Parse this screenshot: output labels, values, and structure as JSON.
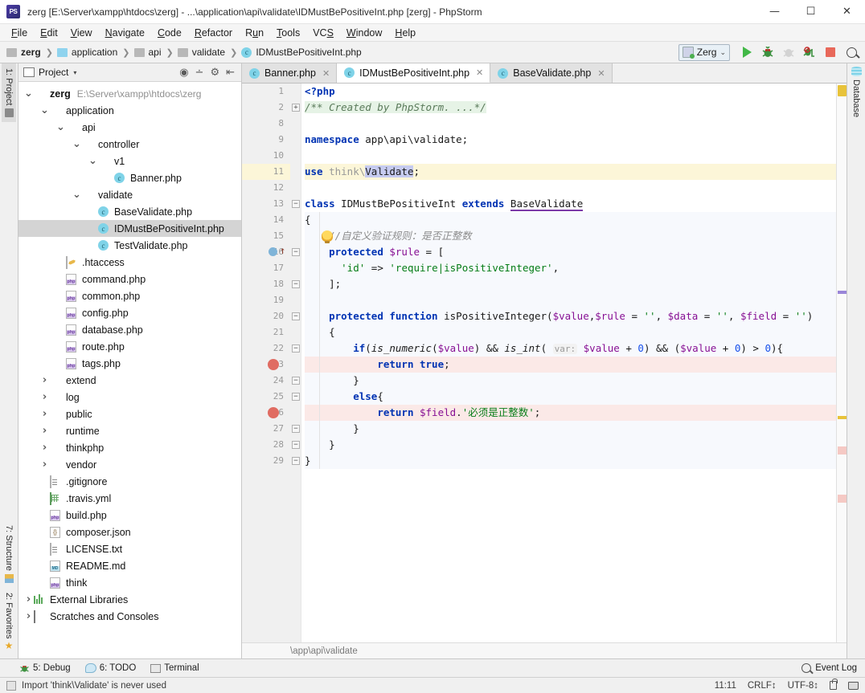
{
  "window": {
    "title": "zerg [E:\\Server\\xampp\\htdocs\\zerg] - ...\\application\\api\\validate\\IDMustBePositiveInt.php [zerg] - PhpStorm",
    "app_name": "PhpStorm",
    "logo_text": "PS",
    "minimize": "—",
    "maximize": "☐",
    "close": "✕"
  },
  "menubar": {
    "items": [
      {
        "label": "File",
        "mnemonic": "F"
      },
      {
        "label": "Edit",
        "mnemonic": "E"
      },
      {
        "label": "View",
        "mnemonic": "V"
      },
      {
        "label": "Navigate",
        "mnemonic": "N"
      },
      {
        "label": "Code",
        "mnemonic": "C"
      },
      {
        "label": "Refactor",
        "mnemonic": "R"
      },
      {
        "label": "Run",
        "mnemonic": "u"
      },
      {
        "label": "Tools",
        "mnemonic": "T"
      },
      {
        "label": "VCS",
        "mnemonic": "S"
      },
      {
        "label": "Window",
        "mnemonic": "W"
      },
      {
        "label": "Help",
        "mnemonic": "H"
      }
    ]
  },
  "breadcrumb": {
    "separator": "❯",
    "items": [
      {
        "label": "zerg",
        "icon": "folder-icon",
        "bold": true
      },
      {
        "label": "application",
        "icon": "folder-blue-icon",
        "bold": false
      },
      {
        "label": "api",
        "icon": "folder-icon",
        "bold": false
      },
      {
        "label": "validate",
        "icon": "folder-icon",
        "bold": false
      },
      {
        "label": "IDMustBePositiveInt.php",
        "icon": "php-class-icon",
        "bold": false
      }
    ]
  },
  "toolbar": {
    "run_config": "Zerg",
    "run_config_chevron": "⌄",
    "buttons": [
      {
        "name": "run-button",
        "icon": "play-icon"
      },
      {
        "name": "debug-button",
        "icon": "bug-icon"
      },
      {
        "name": "rerun-button",
        "icon": "bug-faded-icon"
      },
      {
        "name": "stop-debug-button",
        "icon": "bug-stop-icon"
      },
      {
        "name": "stop-button",
        "icon": "stop-square-icon"
      },
      {
        "name": "search-everywhere-button",
        "icon": "search-icon"
      }
    ]
  },
  "left_rail": {
    "top": [
      {
        "label": "1: Project",
        "mnemonic": "1",
        "active": true
      }
    ],
    "bottom": [
      {
        "label": "7: Structure",
        "mnemonic": "7",
        "active": false
      },
      {
        "label": "2: Favorites",
        "mnemonic": "2",
        "active": false
      }
    ]
  },
  "right_rail": {
    "items": [
      {
        "label": "Database",
        "icon": "database-icon"
      }
    ]
  },
  "project_panel": {
    "title": "Project",
    "caret": "▾",
    "toolbar_icons": [
      "locate-icon",
      "collapse-all-icon",
      "settings-gear-icon",
      "hide-panel-icon"
    ],
    "tree": [
      {
        "depth": 0,
        "arrow": "v",
        "icon": "folder-icon",
        "label": "zerg",
        "bold": true,
        "path": "E:\\Server\\xampp\\htdocs\\zerg",
        "selected": false
      },
      {
        "depth": 1,
        "arrow": "v",
        "icon": "folder-blue-icon",
        "label": "application",
        "bold": false,
        "path": "",
        "selected": false
      },
      {
        "depth": 2,
        "arrow": "v",
        "icon": "folder-icon",
        "label": "api",
        "bold": false,
        "path": "",
        "selected": false
      },
      {
        "depth": 3,
        "arrow": "v",
        "icon": "folder-icon",
        "label": "controller",
        "bold": false,
        "path": "",
        "selected": false
      },
      {
        "depth": 4,
        "arrow": "v",
        "icon": "folder-icon",
        "label": "v1",
        "bold": false,
        "path": "",
        "selected": false
      },
      {
        "depth": 5,
        "arrow": "",
        "icon": "php-class-icon",
        "label": "Banner.php",
        "bold": false,
        "path": "",
        "selected": false
      },
      {
        "depth": 3,
        "arrow": "v",
        "icon": "folder-icon",
        "label": "validate",
        "bold": false,
        "path": "",
        "selected": false
      },
      {
        "depth": 4,
        "arrow": "",
        "icon": "php-class-icon",
        "label": "BaseValidate.php",
        "bold": false,
        "path": "",
        "selected": false
      },
      {
        "depth": 4,
        "arrow": "",
        "icon": "php-class-icon",
        "label": "IDMustBePositiveInt.php",
        "bold": false,
        "path": "",
        "selected": true
      },
      {
        "depth": 4,
        "arrow": "",
        "icon": "php-class-icon",
        "label": "TestValidate.php",
        "bold": false,
        "path": "",
        "selected": false
      },
      {
        "depth": 2,
        "arrow": "",
        "icon": "htaccess-icon",
        "label": ".htaccess",
        "bold": false,
        "path": "",
        "selected": false
      },
      {
        "depth": 2,
        "arrow": "",
        "icon": "php-file-icon",
        "label": "command.php",
        "bold": false,
        "path": "",
        "selected": false
      },
      {
        "depth": 2,
        "arrow": "",
        "icon": "php-file-icon",
        "label": "common.php",
        "bold": false,
        "path": "",
        "selected": false
      },
      {
        "depth": 2,
        "arrow": "",
        "icon": "php-file-icon",
        "label": "config.php",
        "bold": false,
        "path": "",
        "selected": false
      },
      {
        "depth": 2,
        "arrow": "",
        "icon": "php-file-icon",
        "label": "database.php",
        "bold": false,
        "path": "",
        "selected": false
      },
      {
        "depth": 2,
        "arrow": "",
        "icon": "php-file-icon",
        "label": "route.php",
        "bold": false,
        "path": "",
        "selected": false
      },
      {
        "depth": 2,
        "arrow": "",
        "icon": "php-file-icon",
        "label": "tags.php",
        "bold": false,
        "path": "",
        "selected": false
      },
      {
        "depth": 1,
        "arrow": ">",
        "icon": "folder-icon",
        "label": "extend",
        "bold": false,
        "path": "",
        "selected": false
      },
      {
        "depth": 1,
        "arrow": ">",
        "icon": "folder-icon",
        "label": "log",
        "bold": false,
        "path": "",
        "selected": false
      },
      {
        "depth": 1,
        "arrow": ">",
        "icon": "folder-icon",
        "label": "public",
        "bold": false,
        "path": "",
        "selected": false
      },
      {
        "depth": 1,
        "arrow": ">",
        "icon": "folder-icon",
        "label": "runtime",
        "bold": false,
        "path": "",
        "selected": false
      },
      {
        "depth": 1,
        "arrow": ">",
        "icon": "folder-icon",
        "label": "thinkphp",
        "bold": false,
        "path": "",
        "selected": false
      },
      {
        "depth": 1,
        "arrow": ">",
        "icon": "folder-icon",
        "label": "vendor",
        "bold": false,
        "path": "",
        "selected": false
      },
      {
        "depth": 1,
        "arrow": "",
        "icon": "text-file-icon",
        "label": ".gitignore",
        "bold": false,
        "path": "",
        "selected": false
      },
      {
        "depth": 1,
        "arrow": "",
        "icon": "yml-file-icon",
        "label": ".travis.yml",
        "bold": false,
        "path": "",
        "selected": false
      },
      {
        "depth": 1,
        "arrow": "",
        "icon": "php-file-icon",
        "label": "build.php",
        "bold": false,
        "path": "",
        "selected": false
      },
      {
        "depth": 1,
        "arrow": "",
        "icon": "json-file-icon",
        "label": "composer.json",
        "bold": false,
        "path": "",
        "selected": false
      },
      {
        "depth": 1,
        "arrow": "",
        "icon": "text-file-icon",
        "label": "LICENSE.txt",
        "bold": false,
        "path": "",
        "selected": false
      },
      {
        "depth": 1,
        "arrow": "",
        "icon": "md-file-icon",
        "label": "README.md",
        "bold": false,
        "path": "",
        "selected": false
      },
      {
        "depth": 1,
        "arrow": "",
        "icon": "php-file-icon",
        "label": "think",
        "bold": false,
        "path": "",
        "selected": false
      },
      {
        "depth": 0,
        "arrow": ">",
        "icon": "external-libraries-icon",
        "label": "External Libraries",
        "bold": false,
        "path": "",
        "selected": false
      },
      {
        "depth": 0,
        "arrow": ">",
        "icon": "scratches-icon",
        "label": "Scratches and Consoles",
        "bold": false,
        "path": "",
        "selected": false
      }
    ]
  },
  "editor": {
    "tabs": [
      {
        "label": "Banner.php",
        "active": false,
        "icon": "php-class-icon",
        "close": "✕"
      },
      {
        "label": "IDMustBePositiveInt.php",
        "active": true,
        "icon": "php-class-icon",
        "close": "✕"
      },
      {
        "label": "BaseValidate.php",
        "active": false,
        "icon": "php-class-icon",
        "close": "✕"
      }
    ],
    "line_numbers": [
      "1",
      "2",
      "8",
      "9",
      "10",
      "11",
      "12",
      "13",
      "14",
      "15",
      "16",
      "17",
      "18",
      "19",
      "20",
      "21",
      "22",
      "23",
      "24",
      "25",
      "26",
      "27",
      "28",
      "29"
    ],
    "breadcrumb_footer": "\\app\\api\\validate",
    "caret_position": "11:11",
    "code_lines": [
      "<?php",
      "/** Created by PhpStorm. ...*/",
      "",
      "namespace app\\api\\validate;",
      "",
      "use think\\Validate;",
      "",
      "class IDMustBePositiveInt extends BaseValidate",
      "{",
      "    //自定义验证规则：是否正整数",
      "    protected $rule = [",
      "      'id' => 'require|isPositiveInteger',",
      "    ];",
      "",
      "    protected function isPositiveInteger($value,$rule = '', $data = '', $field = '')",
      "    {",
      "        if(is_numeric($value) && is_int( var: $value + 0) && ($value + 0) > 0){",
      "            return true;",
      "        }",
      "        else{",
      "            return $field.'必须是正整数';",
      "        }",
      "    }",
      "}"
    ],
    "breakpoint_lines": [
      23,
      26
    ],
    "method_marker_line": 16,
    "highlighted_line": 11,
    "inlay_hint": "var:"
  },
  "bottom_toolbar": {
    "items": [
      {
        "label": "5: Debug",
        "mnemonic": "5",
        "icon": "debug-bug-icon"
      },
      {
        "label": "6: TODO",
        "mnemonic": "6",
        "icon": "todo-icon"
      },
      {
        "label": "Terminal",
        "mnemonic": "",
        "icon": "terminal-icon"
      }
    ],
    "event_log": "Event Log",
    "event_log_icon": "magnifier-icon"
  },
  "statusbar": {
    "message": "Import 'think\\Validate' is never used",
    "position": "11:11",
    "line_separator": "CRLF↕",
    "encoding": "UTF-8↕",
    "lock_icon": "lock-icon",
    "print_icon": "printer-icon"
  },
  "colors": {
    "keyword": "#0033b3",
    "string": "#067d17",
    "comment": "#8c8c8c",
    "variable": "#871094",
    "number": "#1750eb",
    "breakpoint": "#e06c62",
    "accent_green": "#42b847",
    "selection": "#d4d4d4",
    "highlight_line": "#fcf6d8"
  }
}
